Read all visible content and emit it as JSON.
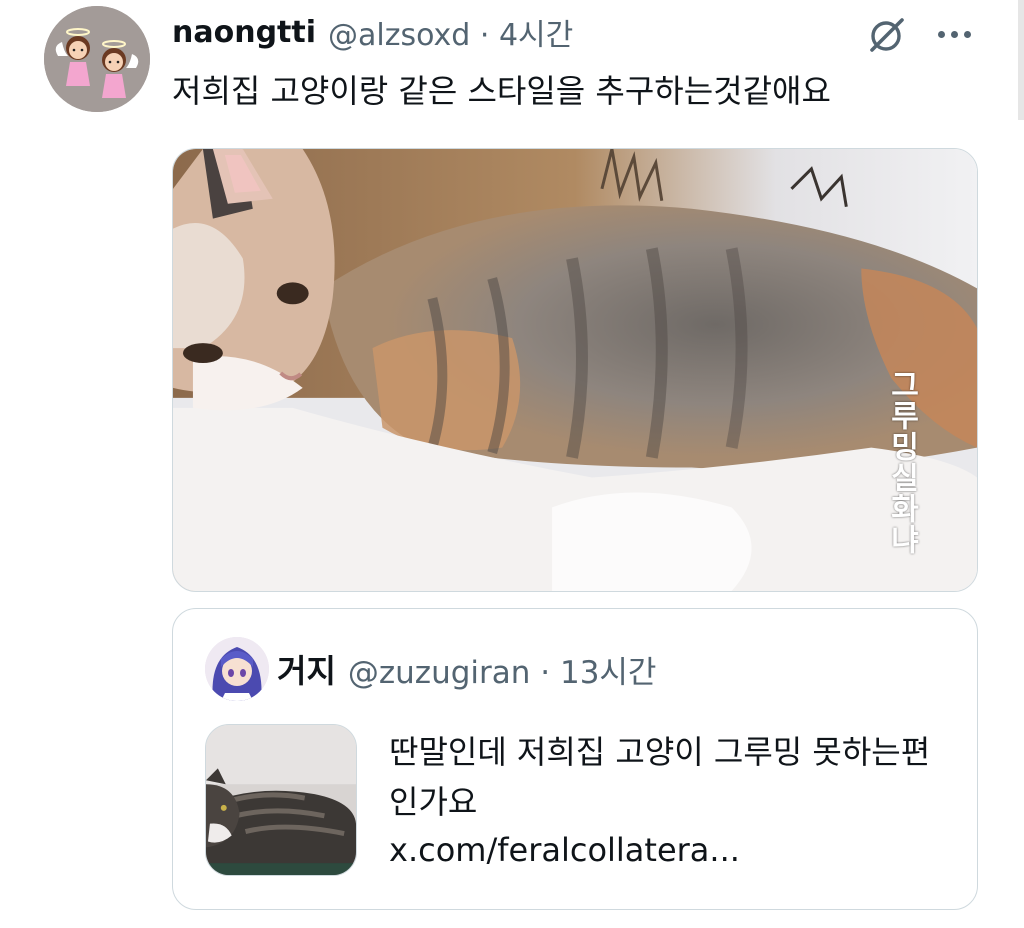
{
  "post": {
    "display_name": "naongtti",
    "handle_meta": "@alzsoxd · 4시간",
    "text": "저희집 고양이랑 같은 스타일을 추구하는것같애요",
    "media_caption": "그루밍실화냐",
    "icons": {
      "avatar": "angel-twins-avatar",
      "grok": "grok-icon",
      "more": "more-icon"
    }
  },
  "quote": {
    "display_name": "거지",
    "handle_meta": "@zuzugiran · 13시간",
    "text": "딴말인데 저희집 고양이 그루밍 못하는편인가요",
    "link": "x.com/feralcollatera...",
    "icons": {
      "avatar": "anime-girl-avatar"
    }
  },
  "colors": {
    "text": "#0f1419",
    "secondary": "#536471",
    "border": "#cfd9de"
  }
}
